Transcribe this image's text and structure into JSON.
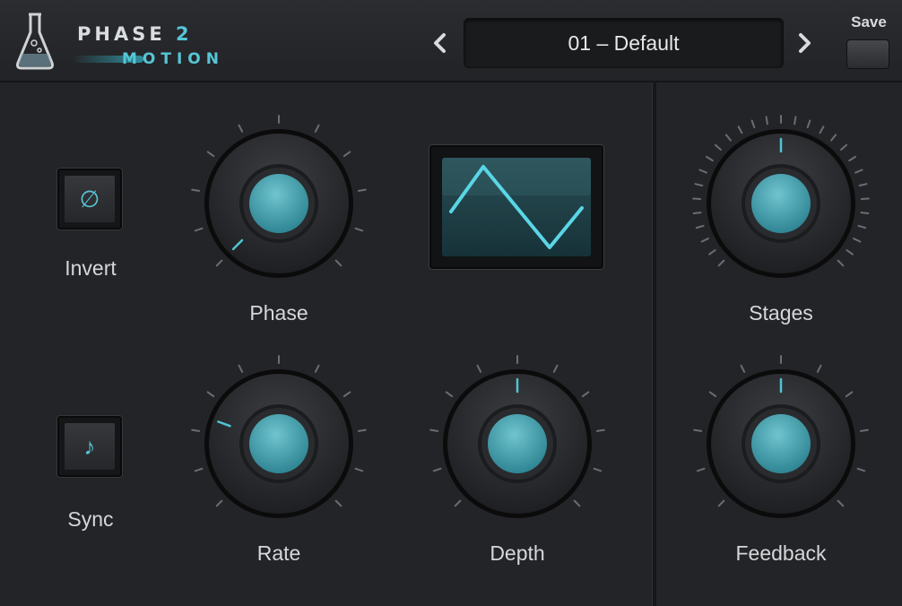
{
  "header": {
    "logo_line1": "PHASE",
    "logo_number": "2",
    "logo_line2": "MOTION",
    "preset_prev_icon": "chevron-left-icon",
    "preset_next_icon": "chevron-right-icon",
    "preset_name": "01 – Default",
    "save_label": "Save"
  },
  "controls": {
    "invert_label": "Invert",
    "invert_icon": "∅",
    "sync_label": "Sync",
    "sync_icon": "♪",
    "phase_label": "Phase",
    "rate_label": "Rate",
    "depth_label": "Depth",
    "stages_label": "Stages",
    "feedback_label": "Feedback",
    "waveform": "triangle"
  },
  "colors": {
    "accent": "#56c6d6",
    "background": "#232427"
  }
}
